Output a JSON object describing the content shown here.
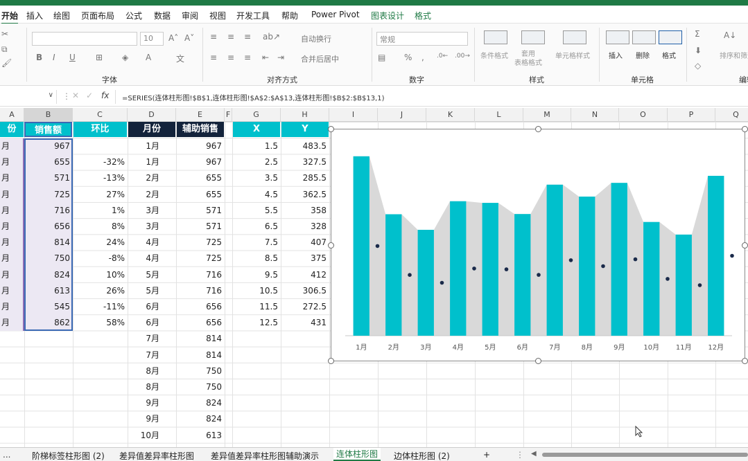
{
  "menu_tabs": [
    "开始",
    "插入",
    "绘图",
    "页面布局",
    "公式",
    "数据",
    "审阅",
    "视图",
    "开发工具",
    "帮助",
    "Power Pivot",
    "图表设计",
    "格式"
  ],
  "ribbon": {
    "groups": [
      "字体",
      "对齐方式",
      "数字",
      "样式",
      "单元格",
      "编辑"
    ],
    "font_size": "10",
    "wrap_text": "自动换行",
    "merge_center": "合并后居中",
    "number_format": "常规",
    "style_buttons": [
      "条件格式",
      "套用\n表格格式",
      "单元格样式"
    ],
    "cell_buttons": [
      "插入",
      "删除",
      "格式"
    ],
    "sort_filter": "排序和筛选"
  },
  "formula_bar": {
    "fx": "fx",
    "formula": "=SERIES(连体柱形图!$B$1,连体柱形图!$A$2:$A$13,连体柱形图!$B$2:$B$13,1)"
  },
  "columns": [
    "A",
    "B",
    "C",
    "D",
    "E",
    "F",
    "G",
    "H",
    "I",
    "J",
    "K",
    "L",
    "M",
    "N",
    "O",
    "P",
    "Q"
  ],
  "headers": {
    "a": "份",
    "b": "销售额",
    "c": "环比",
    "d": "月份",
    "e": "辅助销售",
    "g": "X",
    "h": "Y"
  },
  "table": {
    "a": [
      "月",
      "月",
      "月",
      "月",
      "月",
      "月",
      "月",
      "月",
      "月",
      "月",
      "月",
      "月"
    ],
    "b": [
      "967",
      "655",
      "571",
      "725",
      "716",
      "656",
      "814",
      "750",
      "824",
      "613",
      "545",
      "862"
    ],
    "c": [
      "",
      "-32%",
      "-13%",
      "27%",
      "1%",
      "8%",
      "24%",
      "-8%",
      "10%",
      "26%",
      "-11%",
      "58%"
    ],
    "d": [
      "1月",
      "1月",
      "2月",
      "2月",
      "3月",
      "3月",
      "4月",
      "4月",
      "5月",
      "5月",
      "6月",
      "6月",
      "7月",
      "7月",
      "8月",
      "8月",
      "9月",
      "9月",
      "10月"
    ],
    "e": [
      "967",
      "967",
      "655",
      "655",
      "571",
      "571",
      "725",
      "725",
      "716",
      "716",
      "656",
      "656",
      "814",
      "814",
      "750",
      "750",
      "824",
      "824",
      "613"
    ],
    "g": [
      "1.5",
      "2.5",
      "3.5",
      "4.5",
      "5.5",
      "6.5",
      "7.5",
      "8.5",
      "9.5",
      "10.5",
      "11.5",
      "12.5"
    ],
    "h": [
      "483.5",
      "327.5",
      "285.5",
      "362.5",
      "358",
      "328",
      "407",
      "375",
      "412",
      "306.5",
      "272.5",
      "431"
    ]
  },
  "chart_data": {
    "type": "bar",
    "categories": [
      "1月",
      "2月",
      "3月",
      "4月",
      "5月",
      "6月",
      "7月",
      "8月",
      "9月",
      "10月",
      "11月",
      "12月"
    ],
    "series": [
      {
        "values": [
          967,
          655,
          571,
          725,
          716,
          656,
          814,
          750,
          824,
          613,
          545,
          862
        ]
      },
      {
        "values": [
          483.5,
          327.5,
          285.5,
          362.5,
          358,
          328,
          407,
          375,
          412,
          306.5,
          272.5,
          431
        ]
      }
    ],
    "area_values": [
      967,
      967,
      655,
      655,
      571,
      571,
      725,
      725,
      716,
      716,
      656,
      656,
      814,
      814,
      750,
      750,
      824,
      824,
      613,
      613,
      545,
      545,
      862,
      862
    ],
    "ylim": [
      0,
      1000
    ],
    "colors": {
      "bar": "#00c0cc",
      "area": "#d9d9d9",
      "dot": "#1a2a4a"
    },
    "grid": false,
    "legend": "none"
  },
  "sheet_tabs": [
    "阶梯标签柱形图 (2)",
    "差异值差异率柱形图",
    "差异值差异率柱形图辅助演示",
    "连体柱形图",
    "边体柱形图 (2)"
  ],
  "sheet_nav": {
    "more": "...",
    "add": "+"
  }
}
